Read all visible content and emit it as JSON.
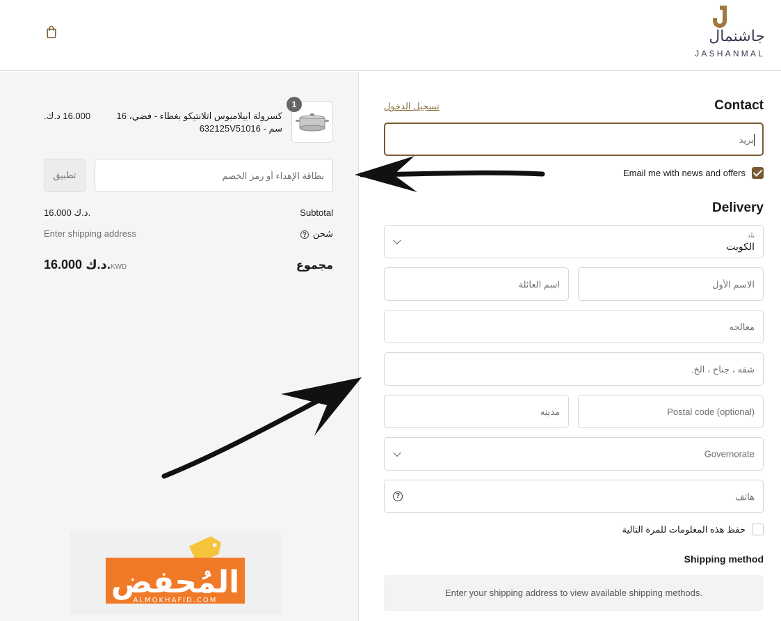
{
  "header": {
    "logo_mark": "J",
    "logo_arabic": "جاشنمال",
    "logo_english": "JASHANMAL",
    "cart_icon": "shopping-bag-icon"
  },
  "order_summary": {
    "item": {
      "quantity": "1",
      "title": "كسرولة ابيلامبوس اتلانتيكو بغطاء - فضي، 16 سم - 632125V51016",
      "price": "16.000 د.ك."
    },
    "discount_placeholder": "بطاقة الإهداء أو رمز الخصم",
    "apply_label": "تطبيق",
    "subtotal_label": "Subtotal",
    "subtotal_value": "16.000 د.ك.",
    "shipping_label": "شحن",
    "shipping_value": "Enter shipping address",
    "total_label": "مجموع",
    "total_currency": "KWD",
    "total_value": "16.000 د.ك."
  },
  "contact": {
    "heading": "Contact",
    "login_link": "تسجيل الدخول",
    "email_placeholder": "بريد",
    "news_checkbox_label": "Email me with news and offers",
    "news_checked": true
  },
  "delivery": {
    "heading": "Delivery",
    "country_label": "بلد",
    "country_value": "الكويت",
    "first_name_placeholder": "الاسم الأول",
    "last_name_placeholder": "اسم العائلة",
    "address_placeholder": "معالجه",
    "apartment_placeholder": "شقه ، جناح ، الخ.",
    "postal_placeholder": "Postal code (optional)",
    "city_placeholder": "مدينه",
    "governorate_placeholder": "Governorate",
    "phone_placeholder": "هاتف",
    "save_info_label": "حفظ هذه المعلومات للمرة التالية",
    "save_info_checked": false
  },
  "shipping": {
    "heading": "Shipping method",
    "message": "Enter your shipping address to view available shipping methods."
  },
  "watermark": {
    "text_arabic": "المُحفض",
    "text_english": "ALMOKHAFID.COM"
  },
  "colors": {
    "accent": "#7a5a32",
    "logo_gold": "#a07a3c",
    "promo_orange": "#f07a28",
    "promo_tag": "#f5c43a"
  }
}
